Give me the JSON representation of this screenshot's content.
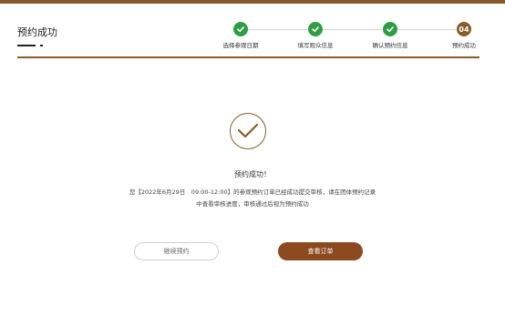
{
  "header": {
    "title": "预约成功"
  },
  "steps": [
    {
      "label": "选择参观日期",
      "status": "done"
    },
    {
      "label": "填写观众信息",
      "status": "done"
    },
    {
      "label": "确认预约信息",
      "status": "done"
    },
    {
      "label": "预约成功",
      "status": "current",
      "number": "04"
    }
  ],
  "result": {
    "title": "预约成功！",
    "message_line1": "您【2022年6月29日　09:00-12:00】的参观预约订单已经成功提交审核，请在团体预约记录",
    "message_line2": "中查看审核进度，审核通过后视为预约成功"
  },
  "actions": {
    "continue_label": "继续预约",
    "view_order_label": "查看订单"
  },
  "colors": {
    "brand": "#8b5a2b",
    "success": "#2e9e44",
    "button": "#8b4a1f"
  }
}
